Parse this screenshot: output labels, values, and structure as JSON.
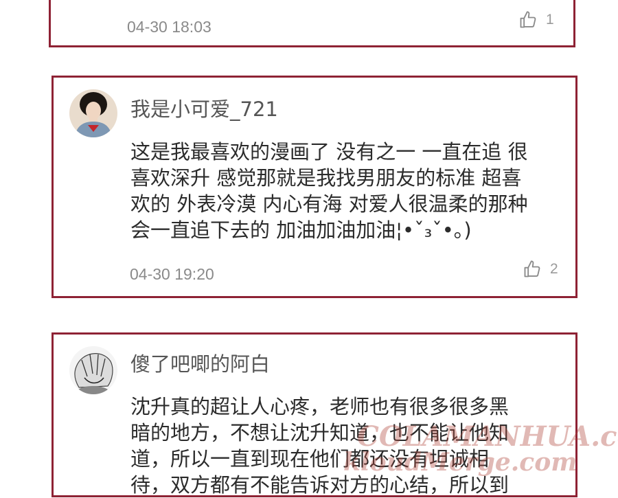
{
  "comments": [
    {
      "time": "04-30 18:03",
      "likes": "1"
    },
    {
      "username": "我是小可爱_721",
      "text": "这是我最喜欢的漫画了 没有之一 一直在追 很\n喜欢深升 感觉那就是我找男朋友的标准 超喜\n欢的 外表冷漠 内心有海 对爱人很温柔的那种\n会一直追下去的 加油加油加油¦•ˇ₃ˇ•｡)",
      "time": "04-30 19:20",
      "likes": "2"
    },
    {
      "username": "傻了吧唧的阿白",
      "text": "沈升真的超让人心疼，老师也有很多很多黑\n暗的地方，不想让沈升知道，也不能让他知\n道，所以一直到现在他们都还没有坦诚相\n待，双方都有不能告诉对方的心结，所以到"
    }
  ],
  "watermark": {
    "line1": "COLAMANHUA.com",
    "line2": "kloudMerge.com"
  },
  "colors": {
    "card_border": "#8e2234",
    "username": "#555555",
    "time": "#8a8a8a"
  },
  "icons": {
    "like": "thumbs-up-icon"
  }
}
